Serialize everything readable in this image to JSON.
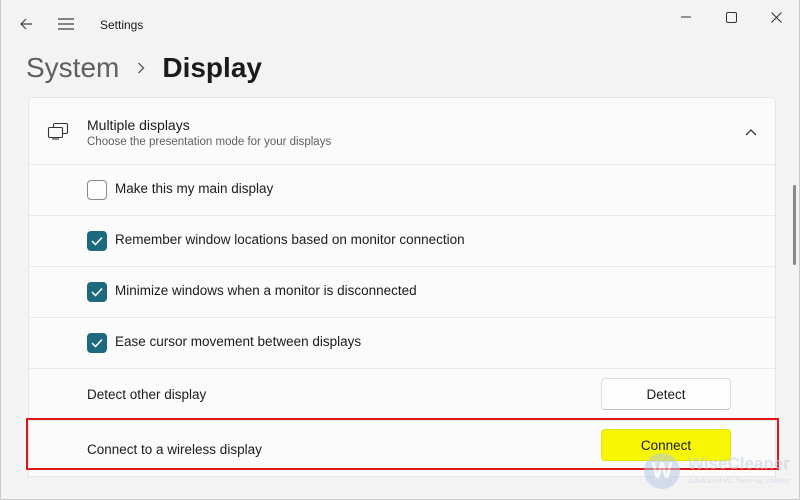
{
  "window": {
    "app_title": "Settings"
  },
  "icons": {
    "back": "back-arrow-icon",
    "menu": "hamburger-menu-icon",
    "minimize": "minimize-icon",
    "maximize": "maximize-icon",
    "close": "close-icon",
    "breadcrumb_separator": "chevron-right-icon",
    "section": "multiple-displays-icon",
    "collapse": "chevron-up-icon",
    "checkmark": "checkmark-icon"
  },
  "breadcrumb": {
    "parent": "System",
    "current": "Display"
  },
  "section": {
    "title": "Multiple displays",
    "subtitle": "Choose the presentation mode for your displays",
    "expanded": true
  },
  "options": [
    {
      "label": "Make this my main display",
      "checked": false
    },
    {
      "label": "Remember window locations based on monitor connection",
      "checked": true
    },
    {
      "label": "Minimize windows when a monitor is disconnected",
      "checked": true
    },
    {
      "label": "Ease cursor movement between displays",
      "checked": true
    }
  ],
  "actions": {
    "detect": {
      "label": "Detect other display",
      "button": "Detect"
    },
    "connect": {
      "label": "Connect to a wireless display",
      "button": "Connect"
    }
  },
  "colors": {
    "accent": "#1d6a7e",
    "highlight_border": "#e0151b",
    "connect_button": "#f7f703"
  },
  "watermark": {
    "name": "WiseCleaner",
    "tagline": "Advanced PC Tune-up Utilities"
  }
}
